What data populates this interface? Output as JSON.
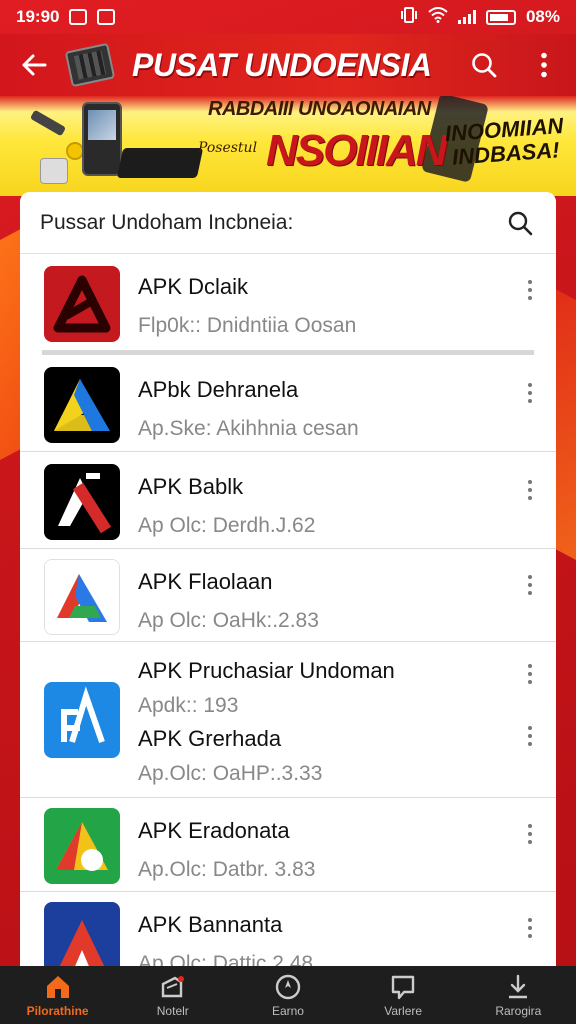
{
  "status_bar": {
    "time": "19:90",
    "battery": "08%"
  },
  "header": {
    "title": "PUSAT UNDOENSIA"
  },
  "banner": {
    "line_top": "RABDAIII UNOAONAIAN",
    "line_small": "Posestul",
    "line_big": "NSOIIIAN",
    "line_right": "INOOMIIAN INDBASA!"
  },
  "search": {
    "text": "Pussar Undoham Incbneia:"
  },
  "list": {
    "items": [
      {
        "title": "APK Dclaik",
        "subtitle": "Flp0k:: Dnidntiia Oosan"
      },
      {
        "title": "APbk Dehranela",
        "subtitle": "Ap.Ske: Akihhnia cesan"
      },
      {
        "title": "APK Bablk",
        "subtitle": "Ap Olc: Derdh.J.62"
      },
      {
        "title": "APK Flaolaan",
        "subtitle": "Ap Olc: OaHk:.2.83"
      },
      {
        "title": "APK Pruchasiar Undoman",
        "subtitle": "Apdk:: 193",
        "title2": "APK Grerhada",
        "subtitle2": "Ap.Olc: OaHP:.3.33"
      },
      {
        "title": "APK Eradonata",
        "subtitle": "Ap.Olc: Datbr. 3.83"
      },
      {
        "title": "APK Bannanta",
        "subtitle": "Ap Olc: Dattic 2.48"
      }
    ]
  },
  "bottom_nav": [
    {
      "label": "Pilorathine",
      "icon": "home-icon",
      "active": true
    },
    {
      "label": "Notelr",
      "icon": "notification-icon",
      "active": false
    },
    {
      "label": "Earno",
      "icon": "compass-icon",
      "active": false
    },
    {
      "label": "Varlere",
      "icon": "message-icon",
      "active": false
    },
    {
      "label": "Rarogira",
      "icon": "download-icon",
      "active": false
    }
  ],
  "colors": {
    "accent_red": "#c8161b",
    "banner_yellow": "#ffe73a",
    "nav_active": "#f26a1a"
  }
}
